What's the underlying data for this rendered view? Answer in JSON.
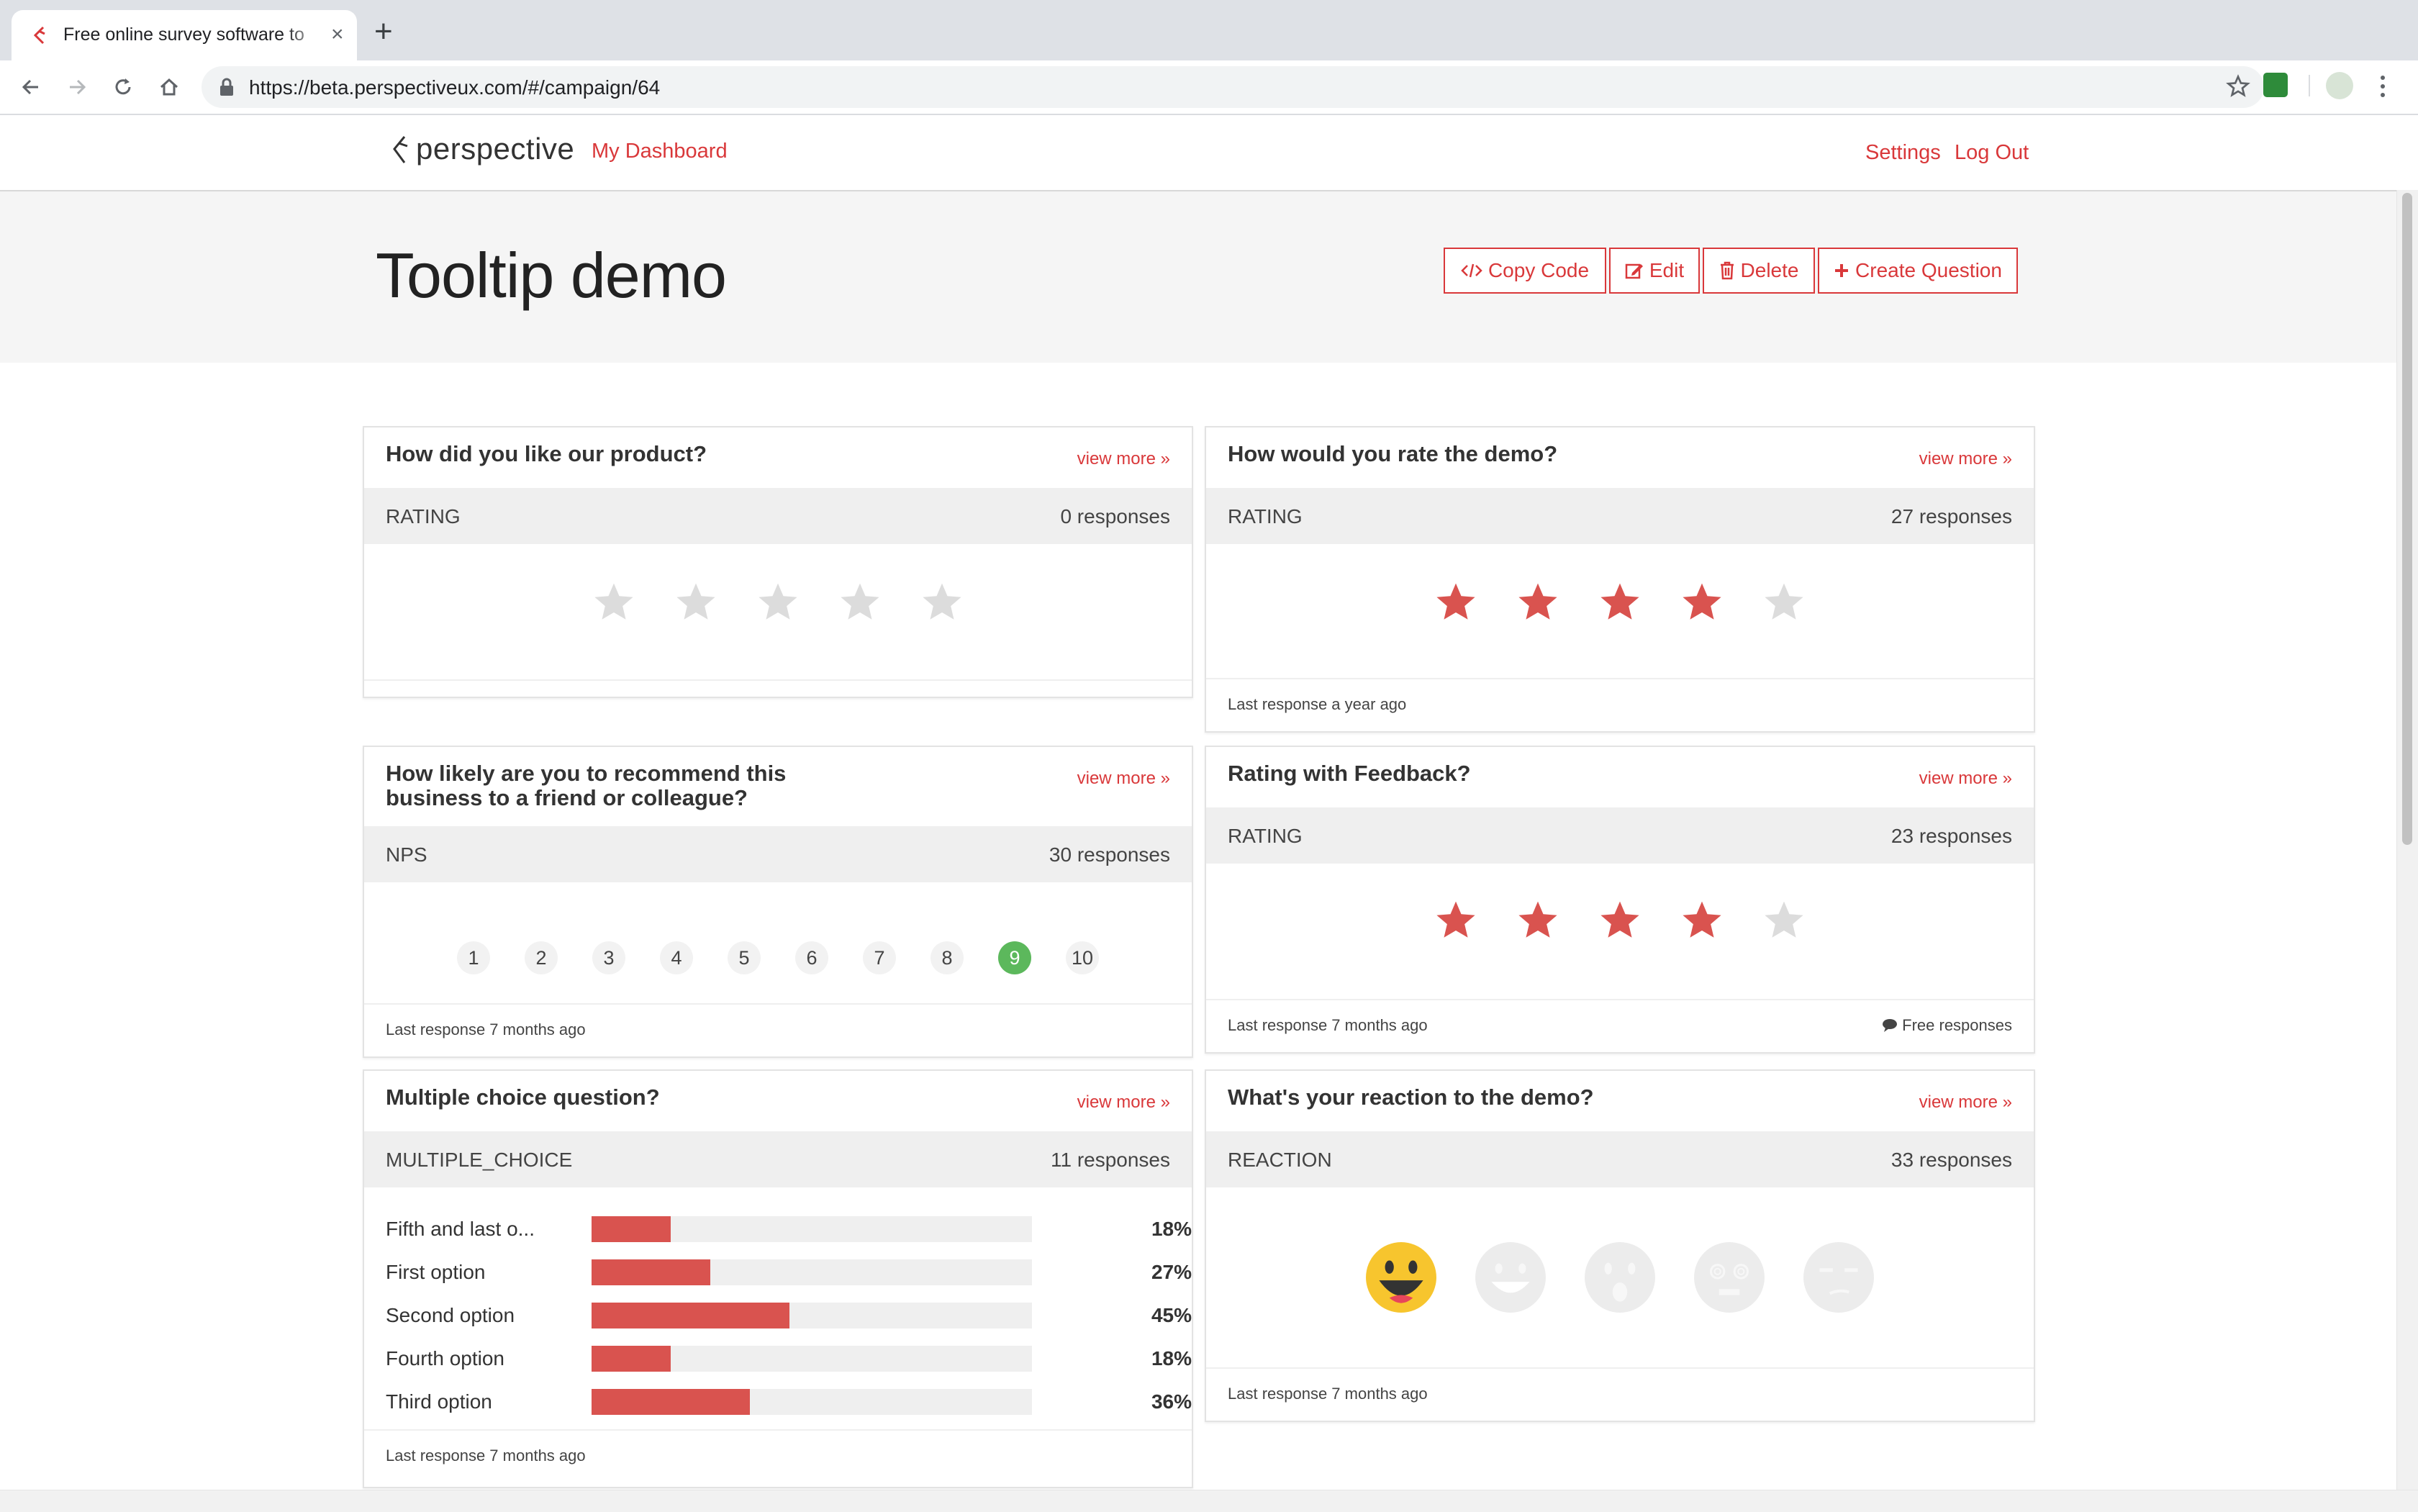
{
  "browser": {
    "tab_title": "Free online survey software to",
    "url": "https://beta.perspectiveux.com/#/campaign/64"
  },
  "header": {
    "logo_text": "perspective",
    "dashboard_link": "My Dashboard",
    "settings_link": "Settings",
    "logout_link": "Log Out"
  },
  "page": {
    "title": "Tooltip demo",
    "buttons": {
      "copy_code": "Copy Code",
      "edit": "Edit",
      "delete": "Delete",
      "create_question": "Create Question"
    }
  },
  "accent_color": "#d9383a",
  "cards": [
    {
      "question": "How did you like our product?",
      "view_more": "view more »",
      "type": "RATING",
      "responses": "0 responses",
      "rating": 0,
      "max": 5,
      "last_response": ""
    },
    {
      "question": "How would you rate the demo?",
      "view_more": "view more »",
      "type": "RATING",
      "responses": "27 responses",
      "rating": 4,
      "max": 5,
      "last_response": "Last response a year ago"
    },
    {
      "question": "How likely are you to recommend this business to a friend or colleague?",
      "view_more": "view more »",
      "type": "NPS",
      "responses": "30 responses",
      "scale": [
        "1",
        "2",
        "3",
        "4",
        "5",
        "6",
        "7",
        "8",
        "9",
        "10"
      ],
      "selected": "9",
      "last_response": "Last response 7 months ago"
    },
    {
      "question": "Rating with Feedback?",
      "view_more": "view more »",
      "type": "RATING",
      "responses": "23 responses",
      "rating": 4,
      "max": 5,
      "last_response": "Last response 7 months ago",
      "free_responses": "Free responses"
    },
    {
      "question": "Multiple choice question?",
      "view_more": "view more »",
      "type": "MULTIPLE_CHOICE",
      "responses": "11 responses",
      "options": [
        {
          "label": "Fifth and last o...",
          "pct": "18%",
          "value": 18
        },
        {
          "label": "First option",
          "pct": "27%",
          "value": 27
        },
        {
          "label": "Second option",
          "pct": "45%",
          "value": 45
        },
        {
          "label": "Fourth option",
          "pct": "18%",
          "value": 18
        },
        {
          "label": "Third option",
          "pct": "36%",
          "value": 36
        }
      ],
      "last_response": "Last response 7 months ago"
    },
    {
      "question": "What's your reaction to the demo?",
      "view_more": "view more »",
      "type": "REACTION",
      "responses": "33 responses",
      "reactions": [
        "happy-face-icon",
        "smile-face-icon",
        "surprised-face-icon",
        "dizzy-face-icon",
        "unamused-face-icon"
      ],
      "selected": 0,
      "last_response": "Last response 7 months ago"
    }
  ]
}
